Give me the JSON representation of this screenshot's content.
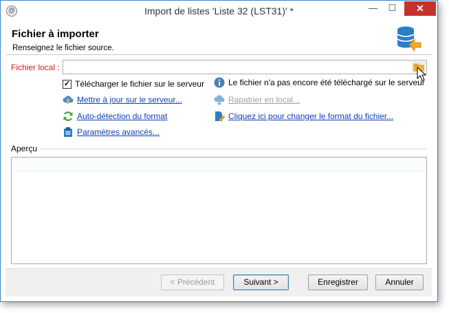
{
  "window": {
    "title": "Import de listes 'Liste 32 (LST31)' *",
    "min_glyph": "—",
    "max_glyph": "☐",
    "close_glyph": "✕"
  },
  "header": {
    "title": "Fichier à importer",
    "subtitle": "Renseignez le fichier source.",
    "icon": "database-import-icon"
  },
  "form": {
    "local_file_label": "Fichier local :",
    "local_file_value": "",
    "upload_checkbox_label": "Télécharger le fichier sur le serveur",
    "upload_checked": true,
    "info_text": "Le fichier n'a pas encore été téléchargé sur le serveur",
    "update_server_link": "Mettre à jour sur le serveur...",
    "repatriate_link": "Rapatrier en local...",
    "auto_detect_link": "Auto-détection du format",
    "change_format_link": "Cliquez ici pour changer le format du fichier...",
    "advanced_params_link": "Paramètres avancés..."
  },
  "preview": {
    "label": "Aperçu"
  },
  "footer": {
    "prev": "< Précédent",
    "next": "Suivant >",
    "save": "Enregistrer",
    "cancel": "Annuler"
  },
  "colors": {
    "required_label": "#d11b1b",
    "link": "#0b3fb4",
    "close_button": "#c7312b",
    "window_border": "#3e83bf"
  }
}
